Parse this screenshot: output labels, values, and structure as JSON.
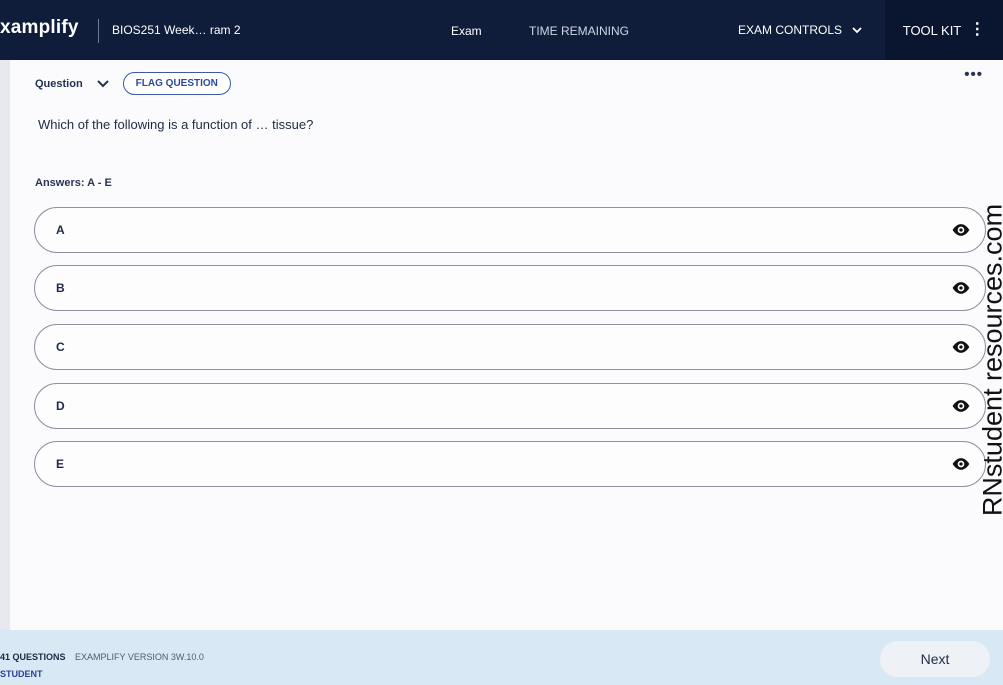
{
  "header": {
    "brand": "xamplify",
    "course": "BIOS251 Week… ram 2",
    "exam_label": "Exam",
    "time_remaining_label": "TIME REMAINING",
    "exam_controls_label": "EXAM CONTROLS",
    "toolkit_label": "TOOL KIT",
    "icons": {
      "exam_controls": "chevron-down-icon",
      "toolkit": "kebab-menu-icon"
    }
  },
  "question": {
    "label": "Question",
    "flag_button": "FLAG QUESTION",
    "text": "Which of the following is a function of … tissue?",
    "answers_header": "Answers: A - E",
    "more_icon": "more-horizontal-icon"
  },
  "answers": [
    {
      "letter": "A",
      "icon": "eye-icon"
    },
    {
      "letter": "B",
      "icon": "eye-icon"
    },
    {
      "letter": "C",
      "icon": "eye-icon"
    },
    {
      "letter": "D",
      "icon": "eye-icon"
    },
    {
      "letter": "E",
      "icon": "eye-icon"
    }
  ],
  "footer": {
    "question_count": "41 QUESTIONS",
    "version": "EXAMPLIFY VERSION 3W.10.0",
    "watermark_logo": "STUDENT",
    "next_button": "Next"
  },
  "side_watermark": "RNstudent resources.com",
  "colors": {
    "topbar": "#0f1d3a",
    "toolkit_bg": "#0a1530",
    "flag_border": "#3a5aa8",
    "footer_bg": "#d8e8f4",
    "answer_border": "#8c939f"
  }
}
